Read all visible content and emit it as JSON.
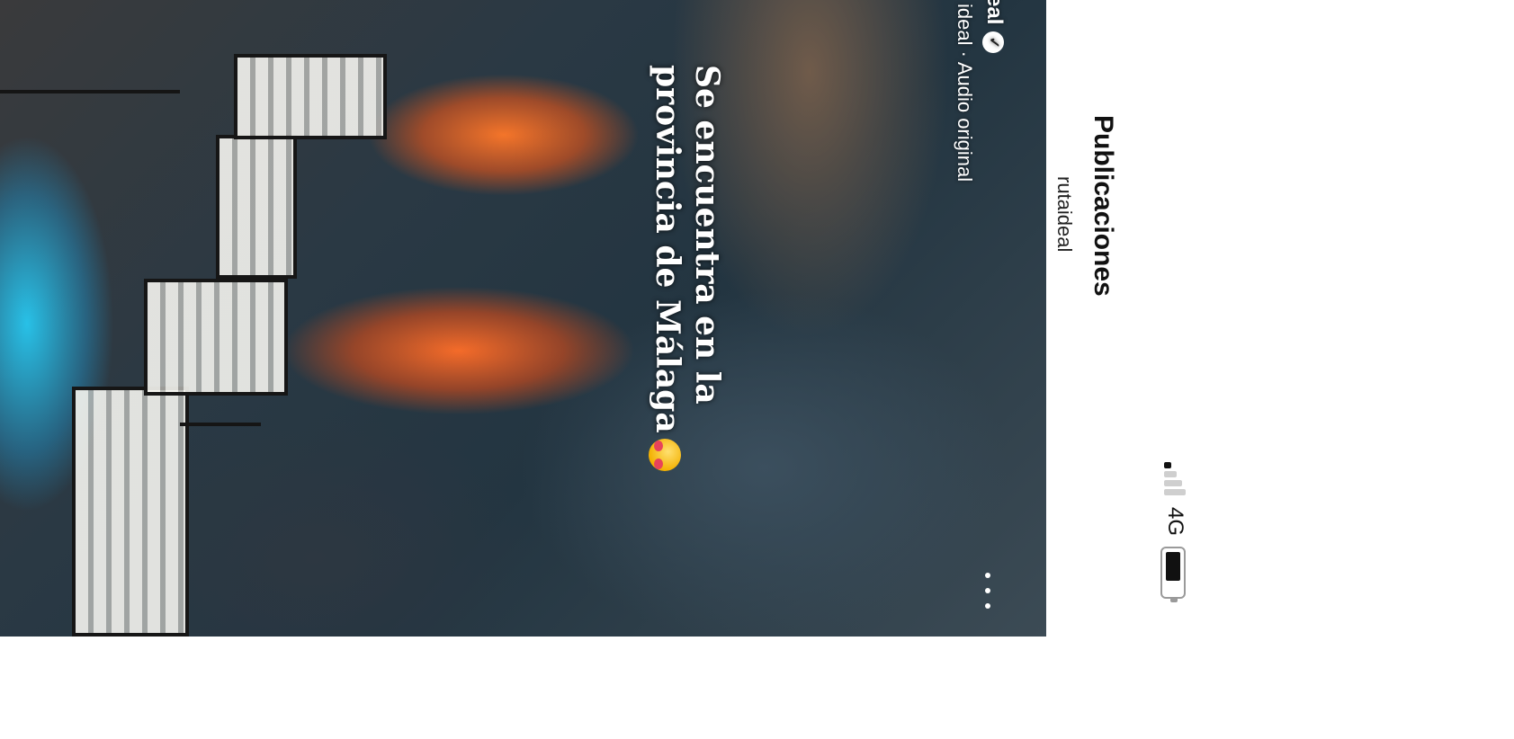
{
  "header": {
    "title": "Publicaciones",
    "subtitle": "rutaideal"
  },
  "status_bar": {
    "network": "4G",
    "signal_icon": "signal-bars-icon",
    "battery_icon": "battery-icon"
  },
  "post": {
    "author_fragment": "eal",
    "author_meta": "ideal · Audio original",
    "caption_line1": "Se encuentra en la",
    "caption_line2": "provincia de Málaga",
    "more_icon": "more-options-icon",
    "verified_icon": "verified-badge-icon"
  }
}
